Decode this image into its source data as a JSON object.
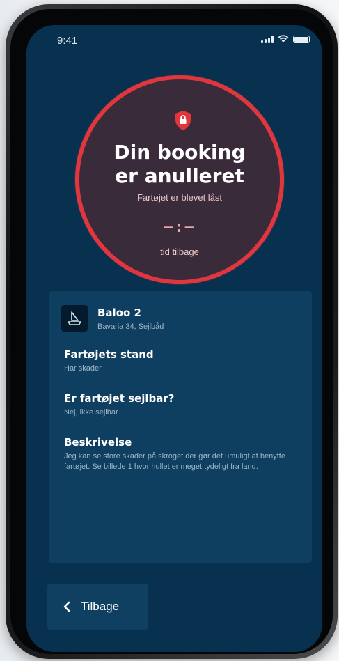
{
  "status_bar": {
    "time": "9:41"
  },
  "status_circle": {
    "title_line1": "Din booking",
    "title_line2": "er anulleret",
    "subtitle": "Fartøjet er blevet låst",
    "timer": "—:—",
    "timer_label": "tid tilbage",
    "accent_color": "#e2363e"
  },
  "boat": {
    "name": "Baloo 2",
    "type": "Bavaria 34, Sejlbåd"
  },
  "sections": [
    {
      "title": "Fartøjets stand",
      "value": "Har skader"
    },
    {
      "title": "Er fartøjet sejlbar?",
      "value": "Nej, ikke sejlbar"
    },
    {
      "title": "Beskrivelse",
      "value": "Jeg kan se store skader på skroget der gør det umuligt at benytte fartøjet. Se billede 1 hvor hullet er meget tydeligt fra land."
    }
  ],
  "back_button": {
    "label": "Tilbage",
    "icon": "chevron-left-icon"
  }
}
